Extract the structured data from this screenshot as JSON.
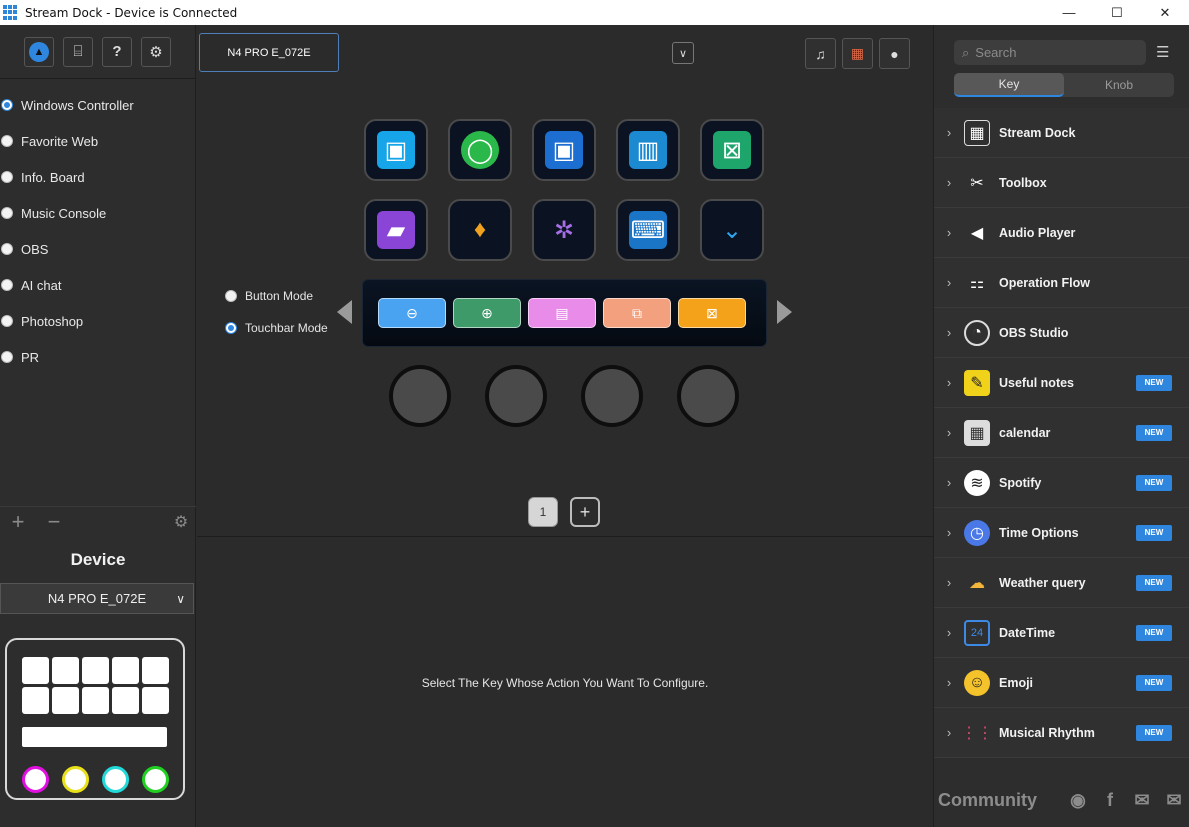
{
  "window": {
    "title": "Stream Dock - Device is Connected"
  },
  "left": {
    "profiles": [
      {
        "label": "Windows Controller",
        "selected": true
      },
      {
        "label": "Favorite Web",
        "selected": false
      },
      {
        "label": "Info. Board",
        "selected": false
      },
      {
        "label": "Music Console",
        "selected": false
      },
      {
        "label": "OBS",
        "selected": false
      },
      {
        "label": "AI chat",
        "selected": false
      },
      {
        "label": "Photoshop",
        "selected": false
      },
      {
        "label": "PR",
        "selected": false
      }
    ],
    "device_heading": "Device",
    "device_selected": "N4 PRO E_072E"
  },
  "center": {
    "device_tab": "N4 PRO E_072E",
    "modes": {
      "button": "Button Mode",
      "touchbar": "Touchbar Mode",
      "selected": "touchbar"
    },
    "page_number": "1",
    "hint": "Select The Key Whose Action You Want To Configure."
  },
  "right": {
    "search_placeholder": "Search",
    "tabs": {
      "key": "Key",
      "knob": "Knob",
      "active": "key"
    },
    "plugins": [
      {
        "label": "Stream Dock",
        "new": false
      },
      {
        "label": "Toolbox",
        "new": false
      },
      {
        "label": "Audio Player",
        "new": false
      },
      {
        "label": "Operation Flow",
        "new": false
      },
      {
        "label": "OBS Studio",
        "new": false
      },
      {
        "label": "Useful notes",
        "new": true
      },
      {
        "label": "calendar",
        "new": true
      },
      {
        "label": "Spotify",
        "new": true
      },
      {
        "label": "Time Options",
        "new": true
      },
      {
        "label": "Weather query",
        "new": true
      },
      {
        "label": "DateTime",
        "new": true
      },
      {
        "label": "Emoji",
        "new": true
      },
      {
        "label": "Musical Rhythm",
        "new": true
      }
    ],
    "badge_text": "NEW",
    "community": "Community"
  },
  "colors": {
    "accent": "#2e86de",
    "background": "#2b2b2b"
  }
}
